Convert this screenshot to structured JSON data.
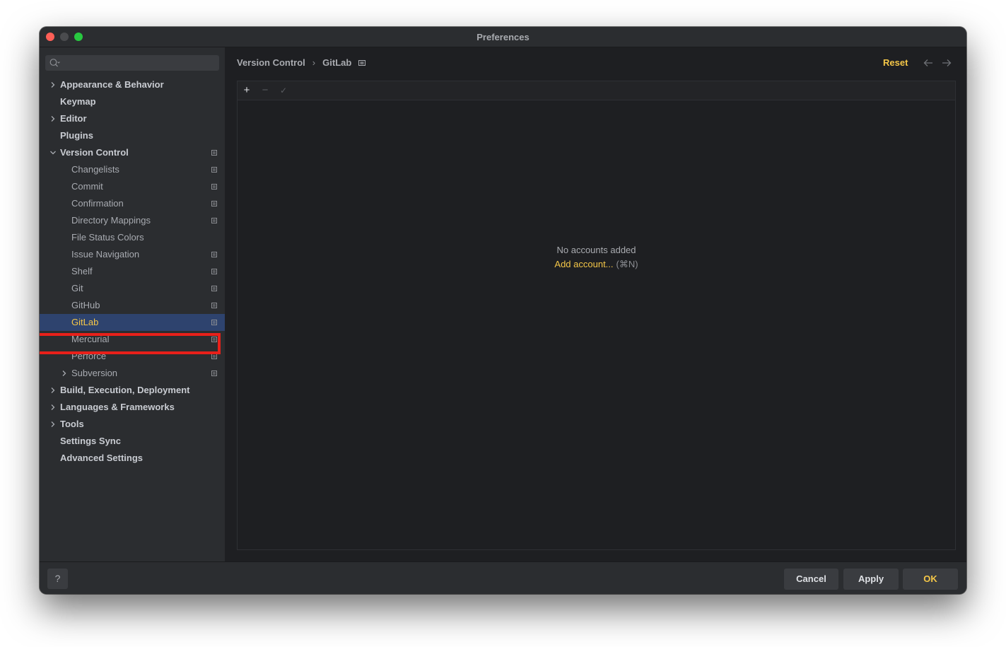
{
  "window": {
    "title": "Preferences"
  },
  "search": {
    "placeholder": ""
  },
  "sidebar": {
    "items": [
      {
        "label": "Appearance & Behavior",
        "expandable": true,
        "expanded": false,
        "bold": true,
        "project_scoped": false
      },
      {
        "label": "Keymap",
        "expandable": false,
        "bold": true,
        "project_scoped": false
      },
      {
        "label": "Editor",
        "expandable": true,
        "expanded": false,
        "bold": true,
        "project_scoped": false
      },
      {
        "label": "Plugins",
        "expandable": false,
        "bold": true,
        "project_scoped": false
      },
      {
        "label": "Version Control",
        "expandable": true,
        "expanded": true,
        "bold": true,
        "project_scoped": true
      },
      {
        "label": "Changelists",
        "indent": 1,
        "project_scoped": true
      },
      {
        "label": "Commit",
        "indent": 1,
        "project_scoped": true
      },
      {
        "label": "Confirmation",
        "indent": 1,
        "project_scoped": true
      },
      {
        "label": "Directory Mappings",
        "indent": 1,
        "project_scoped": true
      },
      {
        "label": "File Status Colors",
        "indent": 1,
        "project_scoped": false
      },
      {
        "label": "Issue Navigation",
        "indent": 1,
        "project_scoped": true
      },
      {
        "label": "Shelf",
        "indent": 1,
        "project_scoped": true
      },
      {
        "label": "Git",
        "indent": 1,
        "project_scoped": true
      },
      {
        "label": "GitHub",
        "indent": 1,
        "project_scoped": true
      },
      {
        "label": "GitLab",
        "indent": 1,
        "project_scoped": true,
        "selected": true
      },
      {
        "label": "Mercurial",
        "indent": 1,
        "project_scoped": true
      },
      {
        "label": "Perforce",
        "indent": 1,
        "project_scoped": true
      },
      {
        "label": "Subversion",
        "indent": 1,
        "expandable": true,
        "expanded": false,
        "project_scoped": true
      },
      {
        "label": "Build, Execution, Deployment",
        "expandable": true,
        "expanded": false,
        "bold": true,
        "project_scoped": false
      },
      {
        "label": "Languages & Frameworks",
        "expandable": true,
        "expanded": false,
        "bold": true,
        "project_scoped": false
      },
      {
        "label": "Tools",
        "expandable": true,
        "expanded": false,
        "bold": true,
        "project_scoped": false
      },
      {
        "label": "Settings Sync",
        "expandable": false,
        "bold": true,
        "project_scoped": false
      },
      {
        "label": "Advanced Settings",
        "expandable": false,
        "bold": true,
        "project_scoped": false
      }
    ]
  },
  "header": {
    "breadcrumb": [
      "Version Control",
      "GitLab"
    ],
    "breadcrumb_separator": "›",
    "reset_label": "Reset",
    "back_icon": "arrow-left-icon",
    "forward_icon": "arrow-right-icon"
  },
  "toolbar": {
    "add_label": "+",
    "remove_label": "−",
    "default_label": "✓"
  },
  "empty_state": {
    "message": "No accounts added",
    "link_label": "Add account...",
    "shortcut": "(⌘N)"
  },
  "footer": {
    "help_label": "?",
    "cancel_label": "Cancel",
    "apply_label": "Apply",
    "ok_label": "OK"
  },
  "colors": {
    "accent": "#f5c748",
    "background": "#1e1f22",
    "sidebar": "#2b2d30",
    "highlight_box": "#e8201a"
  }
}
